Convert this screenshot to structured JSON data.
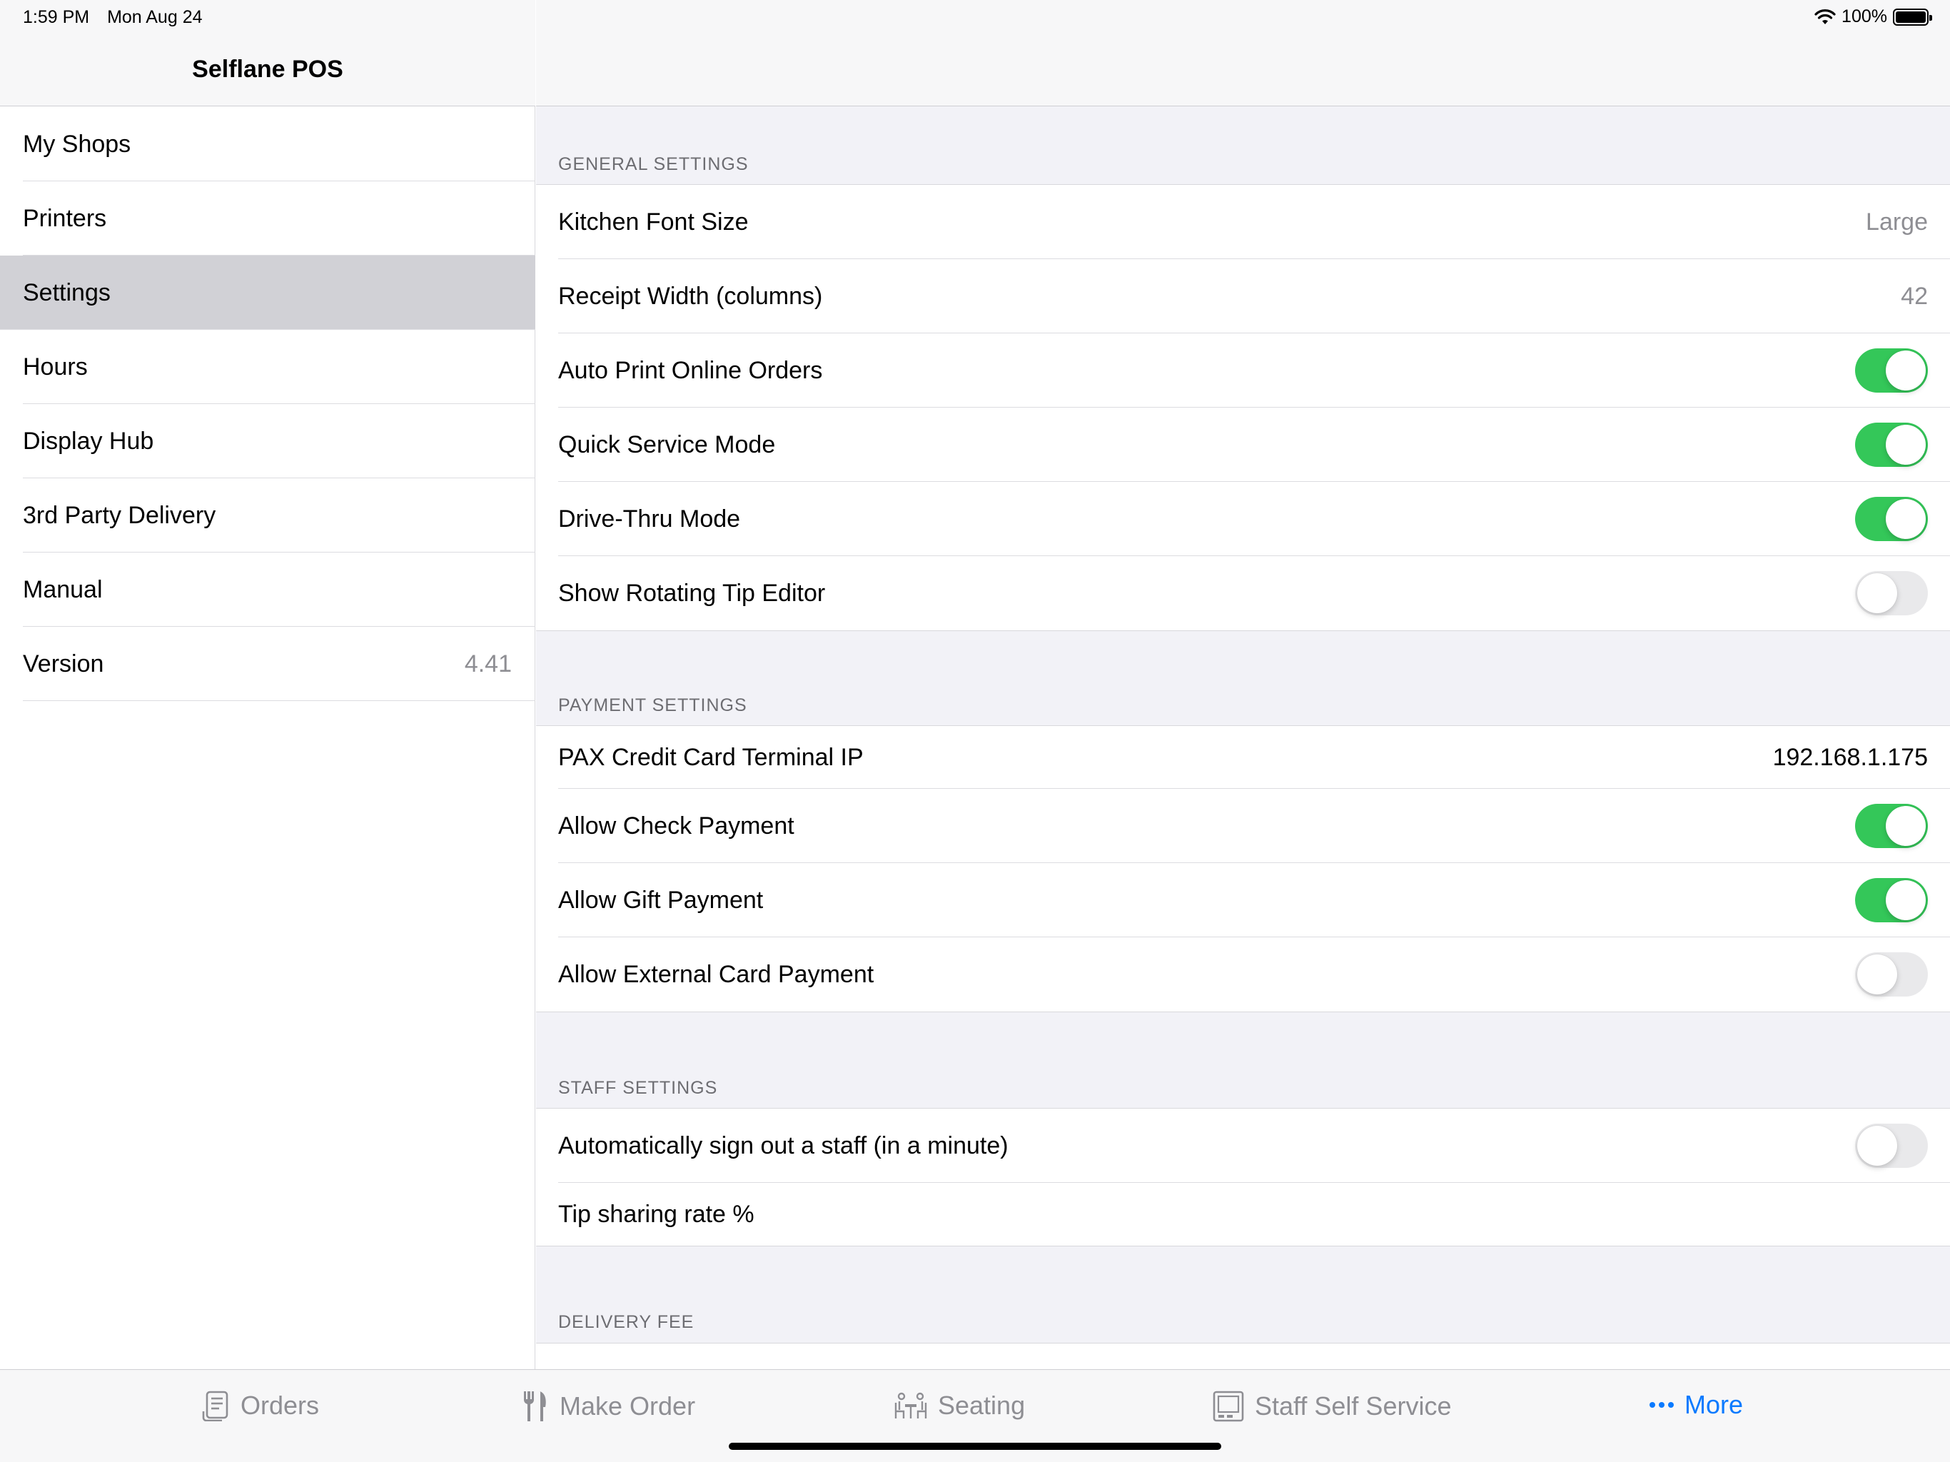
{
  "status": {
    "time": "1:59 PM",
    "date": "Mon Aug 24",
    "battery": "100%"
  },
  "sidebar": {
    "title": "Selflane POS",
    "items": [
      {
        "label": "My Shops"
      },
      {
        "label": "Printers"
      },
      {
        "label": "Settings",
        "selected": true
      },
      {
        "label": "Hours"
      },
      {
        "label": "Display Hub"
      },
      {
        "label": "3rd Party Delivery"
      },
      {
        "label": "Manual"
      },
      {
        "label": "Version",
        "value": "4.41"
      }
    ]
  },
  "detail": {
    "general": {
      "header": "GENERAL SETTINGS",
      "rows": [
        {
          "label": "Kitchen Font Size",
          "value": "Large"
        },
        {
          "label": "Receipt Width (columns)",
          "value": "42"
        },
        {
          "label": "Auto Print Online Orders",
          "toggle": true
        },
        {
          "label": "Quick Service Mode",
          "toggle": true
        },
        {
          "label": "Drive-Thru Mode",
          "toggle": true
        },
        {
          "label": "Show Rotating Tip Editor",
          "toggle": false
        }
      ]
    },
    "payment": {
      "header": "PAYMENT SETTINGS",
      "rows": [
        {
          "label": "PAX Credit Card Terminal IP",
          "value": "192.168.1.175"
        },
        {
          "label": "Allow Check Payment",
          "toggle": true
        },
        {
          "label": "Allow Gift Payment",
          "toggle": true
        },
        {
          "label": "Allow External Card Payment",
          "toggle": false
        }
      ]
    },
    "staff": {
      "header": "STAFF SETTINGS",
      "rows": [
        {
          "label": "Automatically sign out a staff (in a minute)",
          "toggle": false
        },
        {
          "label": "Tip sharing rate %"
        }
      ]
    },
    "delivery": {
      "header": "DELIVERY FEE"
    }
  },
  "tabbar": {
    "items": [
      {
        "label": "Orders",
        "icon": "orders-icon"
      },
      {
        "label": "Make Order",
        "icon": "fork-knife-icon"
      },
      {
        "label": "Seating",
        "icon": "seating-icon"
      },
      {
        "label": "Staff Self Service",
        "icon": "staff-terminal-icon"
      },
      {
        "label": "More",
        "icon": "more-dots-icon",
        "active": true
      }
    ]
  },
  "colors": {
    "accent": "#0a7aff",
    "toggle_on": "#34c759",
    "selected_bg": "#d1d1d6",
    "group_bg": "#f2f2f7"
  }
}
